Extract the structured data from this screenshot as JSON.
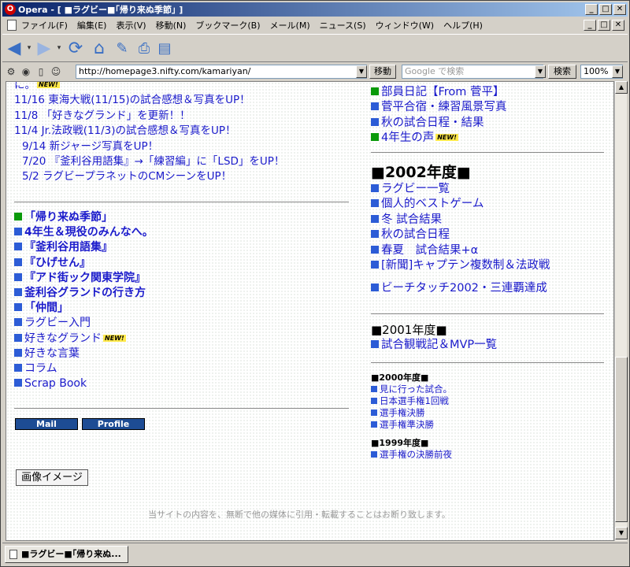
{
  "window": {
    "title": "Opera - [ ■ラグビー■｢帰り来ぬ季節｣ ]",
    "controls": {
      "minimize": "_",
      "maximize": "□",
      "close": "✕"
    }
  },
  "menu": [
    "ファイル(F)",
    "編集(E)",
    "表示(V)",
    "移動(N)",
    "ブックマーク(B)",
    "メール(M)",
    "ニュース(S)",
    "ウィンドウ(W)",
    "ヘルプ(H)"
  ],
  "toolbar": {
    "address": "http://homepage3.nifty.com/kamariyan/",
    "go_label": "移動",
    "search_placeholder": "Google で検索",
    "search_label": "検索",
    "zoom": "100%"
  },
  "left": {
    "news": [
      {
        "text": "に。",
        "new": true,
        "indent": false
      },
      {
        "text": "11/16 東海大戦(11/15)の試合感想＆写真をUP！",
        "new": false,
        "indent": false
      },
      {
        "text": "11/8 「好きなグランド」を更新！！",
        "new": false,
        "indent": false
      },
      {
        "text": "11/4 Jr.法政戦(11/3)の試合感想＆写真をUP！",
        "new": false,
        "indent": false
      },
      {
        "text": "9/14 新ジャージ写真をUP！",
        "new": false,
        "indent": true
      },
      {
        "text": "7/20 『釜利谷用語集』→「練習編」に「LSD」をUP！",
        "new": false,
        "indent": true
      },
      {
        "text": "5/2 ラグビープラネットのCMシーンをUP！",
        "new": false,
        "indent": true
      }
    ],
    "links": [
      {
        "text": "「帰り来ぬ季節」",
        "bold": true,
        "green": true,
        "new": false
      },
      {
        "text": "4年生＆現役のみんなへ。",
        "bold": true,
        "green": false,
        "new": false
      },
      {
        "text": "『釜利谷用語集』",
        "bold": true,
        "green": false,
        "new": false
      },
      {
        "text": "『ひげせん』",
        "bold": true,
        "green": false,
        "new": false
      },
      {
        "text": "『アド街ック関東学院』",
        "bold": true,
        "green": false,
        "new": false
      },
      {
        "text": "釜利谷グランドの行き方",
        "bold": true,
        "green": false,
        "new": false
      },
      {
        "text": "「仲間」",
        "bold": true,
        "green": false,
        "new": false
      },
      {
        "text": "ラグビー入門",
        "bold": false,
        "green": false,
        "new": false
      },
      {
        "text": "好きなグランド",
        "bold": false,
        "green": false,
        "new": true
      },
      {
        "text": "好きな言葉",
        "bold": false,
        "green": false,
        "new": false
      },
      {
        "text": "コラム",
        "bold": false,
        "green": false,
        "new": false
      },
      {
        "text": "Scrap Book",
        "bold": false,
        "green": false,
        "new": false
      }
    ],
    "mail_label": "Mail",
    "profile_label": "Profile",
    "image_button": "画像イメージ",
    "footer": "当サイトの内容を、無断で他の媒体に引用・転載することはお断り致します。"
  },
  "right": {
    "top_links": [
      {
        "text": "部員日記【From 菅平】",
        "green": true,
        "new": false
      },
      {
        "text": "菅平合宿・練習風景写真",
        "green": false,
        "new": false
      },
      {
        "text": "秋の試合日程・結果",
        "green": false,
        "new": false
      },
      {
        "text": "4年生の声",
        "green": true,
        "new": true
      }
    ],
    "h2002": "■2002年度■",
    "links2002": [
      "ラグビー一覧",
      "個人的ベストゲーム",
      "冬 試合結果",
      "秋の試合日程",
      "春夏　試合結果+α",
      "[新聞]キャプテン複数制＆法政戦"
    ],
    "beach": "ビーチタッチ2002・三連覇達成",
    "h2001": "■2001年度■",
    "links2001": [
      "試合観戦記＆MVP一覧"
    ],
    "h2000": "■2000年度■",
    "links2000": [
      "見に行った試合。",
      "日本選手権1回戦",
      "選手権決勝",
      "選手権準決勝"
    ],
    "h1999": "■1999年度■",
    "links1999": [
      "選手権の決勝前夜"
    ]
  },
  "new_badge": "NEW!",
  "status": {
    "tab": "■ラグビー■｢帰り来ぬ..."
  }
}
